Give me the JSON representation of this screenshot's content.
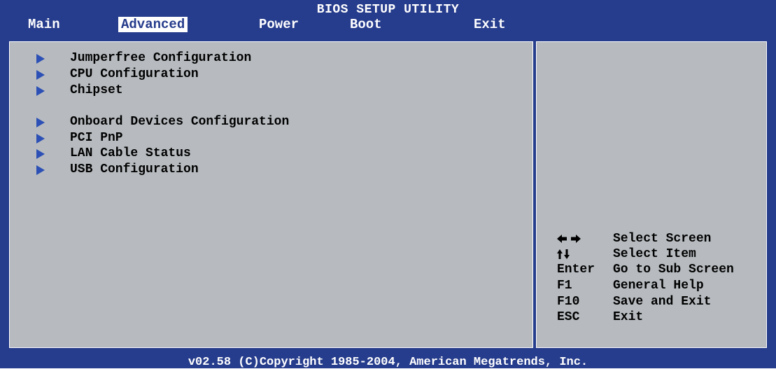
{
  "header": {
    "title": "BIOS SETUP UTILITY",
    "tabs": [
      "Main",
      "Advanced",
      "Power",
      "Boot",
      "Exit"
    ],
    "active_tab": "Advanced"
  },
  "menu": {
    "items": [
      "Jumperfree Configuration",
      "CPU Configuration",
      "Chipset",
      "Onboard Devices Configuration",
      "PCI PnP",
      "LAN Cable Status",
      "USB Configuration"
    ]
  },
  "help": {
    "keys": [
      {
        "key_icon": "left-right-arrows-icon",
        "desc": "Select Screen"
      },
      {
        "key_icon": "up-down-arrows-icon",
        "desc": "Select Item"
      },
      {
        "key": "Enter",
        "desc": "Go to Sub Screen"
      },
      {
        "key": "F1",
        "desc": "General Help"
      },
      {
        "key": "F10",
        "desc": "Save and Exit"
      },
      {
        "key": "ESC",
        "desc": "Exit"
      }
    ]
  },
  "footer": {
    "text": "v02.58 (C)Copyright 1985-2004, American Megatrends, Inc."
  },
  "colors": {
    "frame_blue": "#263c8c",
    "panel_gray": "#b7bbbf",
    "arrow_blue": "#2c50b5"
  }
}
